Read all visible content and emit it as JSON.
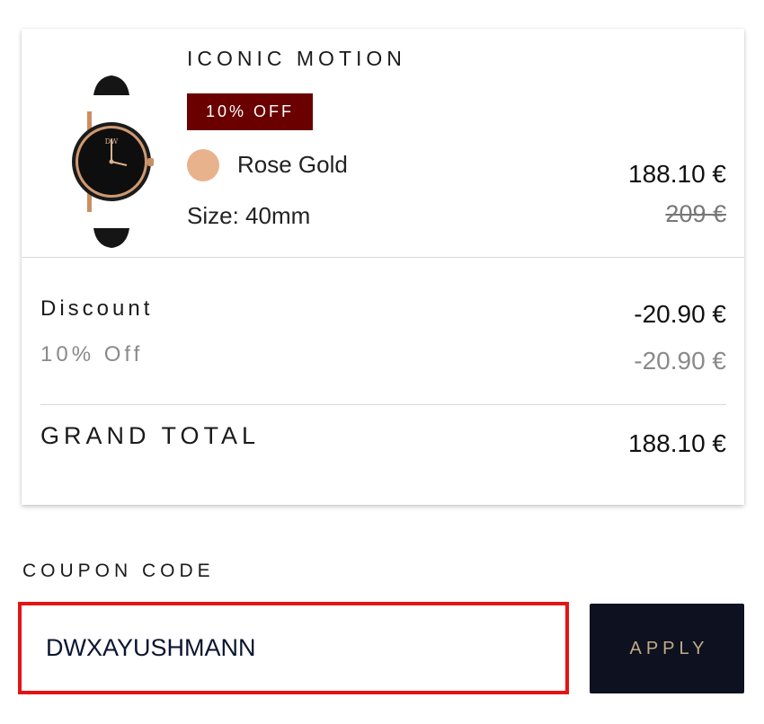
{
  "product": {
    "name": "ICONIC MOTION",
    "badge": "10% OFF",
    "color_name": "Rose Gold",
    "size_label": "Size:",
    "size_value": "40mm",
    "price_current": "188.10 €",
    "price_original": "209 €",
    "image_icon": "black-watch-icon"
  },
  "discount": {
    "label": "Discount",
    "sub_label": "10% Off",
    "amount": "-20.90 €",
    "sub_amount": "-20.90 €"
  },
  "total": {
    "label": "GRAND TOTAL",
    "value": "188.10 €"
  },
  "coupon": {
    "label": "COUPON CODE",
    "value": "DWXAYUSHMANN",
    "apply_label": "APPLY"
  },
  "colors": {
    "badge_bg": "#6a0000",
    "swatch_rose_gold": "#e8b38c",
    "apply_bg": "#0d1120",
    "apply_text": "#c2ab84",
    "input_border_highlight": "#e31414"
  }
}
